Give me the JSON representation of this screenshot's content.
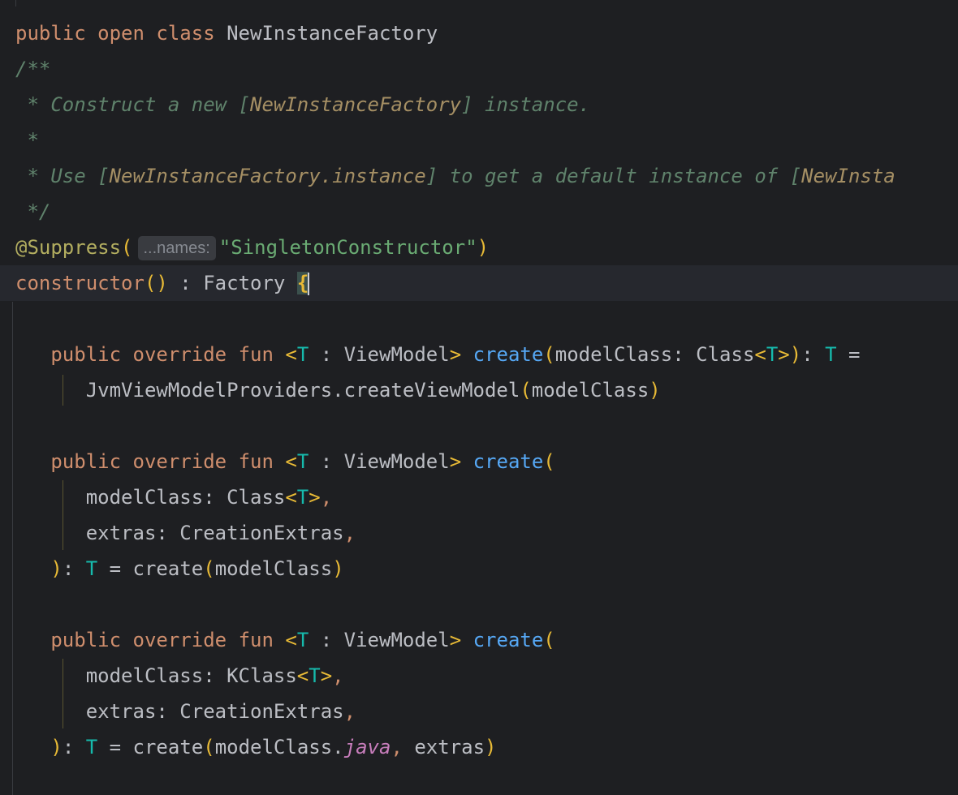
{
  "editor": {
    "lines": {
      "l1": {
        "kw1": "public",
        "kw2": "open",
        "kw3": "class",
        "name": "NewInstanceFactory"
      },
      "l2": {
        "doc": "/**"
      },
      "l3": {
        "doc_a": " * Construct a new ",
        "link_open": "[",
        "link": "NewInstanceFactory",
        "link_close": "]",
        "doc_b": " instance."
      },
      "l4": {
        "doc": " *"
      },
      "l5": {
        "doc_a": " * Use ",
        "link_open": "[",
        "link": "NewInstanceFactory.instance",
        "link_close": "]",
        "doc_b": " to get a default instance of ",
        "link2_open": "[",
        "link2": "NewInsta"
      },
      "l6": {
        "doc": " */"
      },
      "l7": {
        "ann": "@Suppress",
        "open": "(",
        "hint": "...names:",
        "str": "\"SingletonConstructor\"",
        "close": ")"
      },
      "l8": {
        "kw": "constructor",
        "parens": "()",
        "colon": " : ",
        "type": "Factory",
        "brace": "{"
      },
      "l10": {
        "kw1": "public",
        "kw2": "override",
        "kw3": "fun",
        "lt": "<",
        "tp": "T",
        "colon": " : ",
        "bound": "ViewModel",
        "gt": ">",
        "fn": "create",
        "open": "(",
        "param": "modelClass: Class",
        "lt2": "<",
        "tp2": "T",
        "gt2": ">",
        "close": ")",
        "ret": ": ",
        "rtp": "T",
        "eq": " ="
      },
      "l11": {
        "call": "JvmViewModelProviders.createViewModel",
        "open": "(",
        "arg": "modelClass",
        "close": ")"
      },
      "l13": {
        "kw1": "public",
        "kw2": "override",
        "kw3": "fun",
        "lt": "<",
        "tp": "T",
        "colon": " : ",
        "bound": "ViewModel",
        "gt": ">",
        "fn": "create",
        "open": "("
      },
      "l14": {
        "param": "modelClass: Class",
        "lt": "<",
        "tp": "T",
        "gt": ">",
        "comma": ","
      },
      "l15": {
        "param": "extras: CreationExtras",
        "comma": ","
      },
      "l16": {
        "close": ")",
        "ret": ": ",
        "tp": "T",
        "eq": " = ",
        "call": "create",
        "open": "(",
        "arg": "modelClass",
        "close2": ")"
      },
      "l18": {
        "kw1": "public",
        "kw2": "override",
        "kw3": "fun",
        "lt": "<",
        "tp": "T",
        "colon": " : ",
        "bound": "ViewModel",
        "gt": ">",
        "fn": "create",
        "open": "("
      },
      "l19": {
        "param": "modelClass: KClass",
        "lt": "<",
        "tp": "T",
        "gt": ">",
        "comma": ","
      },
      "l20": {
        "param": "extras: CreationExtras",
        "comma": ","
      },
      "l21": {
        "close": ")",
        "ret": ": ",
        "tp": "T",
        "eq": " = ",
        "call": "create",
        "open": "(",
        "arg": "modelClass.",
        "ext": "java",
        "sep": ", ",
        "arg2": "extras",
        "close2": ")"
      }
    }
  },
  "colors": {
    "background": "#1e1f22",
    "keyword": "#cf8e6d",
    "doc_comment": "#5f826b",
    "string": "#6aab73",
    "annotation": "#b3ae60",
    "type_param": "#16baac",
    "function": "#56a8f5",
    "bracket": "#e8ba36"
  }
}
